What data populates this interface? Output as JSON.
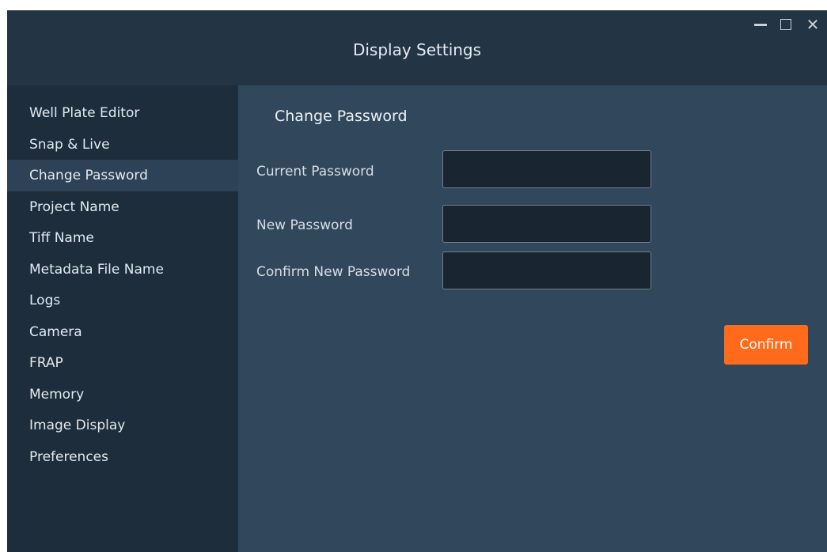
{
  "window": {
    "title": "Display Settings",
    "controls": {
      "minimize_icon": "minimize-icon",
      "maximize_icon": "maximize-icon",
      "close_icon": "close-icon",
      "close_glyph": "✕"
    }
  },
  "sidebar": {
    "active_index": 2,
    "items": [
      {
        "label": "Well Plate Editor"
      },
      {
        "label": "Snap & Live"
      },
      {
        "label": "Change Password"
      },
      {
        "label": "Project Name"
      },
      {
        "label": "Tiff Name"
      },
      {
        "label": "Metadata File Name"
      },
      {
        "label": "Logs"
      },
      {
        "label": "Camera"
      },
      {
        "label": "FRAP"
      },
      {
        "label": "Memory"
      },
      {
        "label": "Image Display"
      },
      {
        "label": "Preferences"
      }
    ]
  },
  "main": {
    "section_title": "Change Password",
    "fields": {
      "current": {
        "label": "Current Password",
        "value": ""
      },
      "new": {
        "label": "New Password",
        "value": ""
      },
      "confirm": {
        "label": "Confirm New Password",
        "value": ""
      }
    },
    "confirm_label": "Confirm"
  },
  "colors": {
    "accent": "#ff6b1a",
    "titlebar": "#233444",
    "sidebar": "#1e2d3b",
    "sidebar_active": "#2d4256",
    "content": "#30475c"
  }
}
